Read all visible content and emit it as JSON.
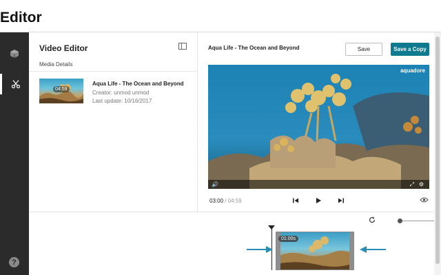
{
  "page": {
    "title": "Editor"
  },
  "nav": {
    "items": [
      {
        "icon": "cube-icon",
        "active": false
      },
      {
        "icon": "scissors-icon",
        "active": true
      }
    ],
    "help_label": "?"
  },
  "left_panel": {
    "title": "Video Editor",
    "section": "Media Details",
    "media": {
      "duration": "04:59",
      "title": "Aqua Life - The Ocean and Beyond",
      "creator": "Creator: unmod unmod",
      "updated": "Last update: 10/16/2017"
    }
  },
  "right_panel": {
    "video_title": "Aqua Life - The Ocean and Beyond",
    "save_label": "Save",
    "save_copy_label": "Save a Copy",
    "watermark": "aquadore",
    "player": {
      "current_time": "03:00",
      "total_time": "/ 04:59",
      "progress": 0.6
    }
  },
  "timeline": {
    "clip_time": "01:00s",
    "zoom_level": 0.05
  },
  "colors": {
    "accent": "#0d7a8f",
    "nav_bg": "#2b2b2b",
    "arrow": "#2a8db5"
  }
}
